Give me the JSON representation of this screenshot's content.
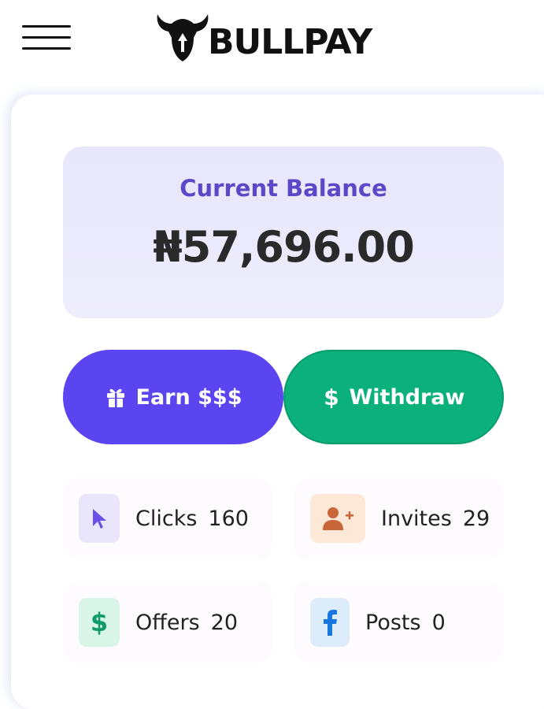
{
  "header": {
    "brand": "BULLPAY"
  },
  "balance": {
    "title": "Current Balance",
    "amount": "₦57,696.00"
  },
  "actions": {
    "earn_label": "Earn $$$",
    "withdraw_label": "Withdraw"
  },
  "stats": [
    {
      "label": "Clicks",
      "value": "160",
      "icon": "cursor-icon",
      "color": "#6b50e6",
      "bg": "#e9e6fb"
    },
    {
      "label": "Invites",
      "value": "29",
      "icon": "add-user-icon",
      "color": "#c8663a",
      "bg": "#fde8d8"
    },
    {
      "label": "Offers",
      "value": "20",
      "icon": "dollar-icon",
      "color": "#119b6a",
      "bg": "#d8f5e8"
    },
    {
      "label": "Posts",
      "value": "0",
      "icon": "facebook-icon",
      "color": "#1776e0",
      "bg": "#dcecfb"
    }
  ],
  "colors": {
    "accent_purple": "#5b45f0",
    "accent_green": "#0bb07a",
    "balance_title": "#5b47c8"
  }
}
